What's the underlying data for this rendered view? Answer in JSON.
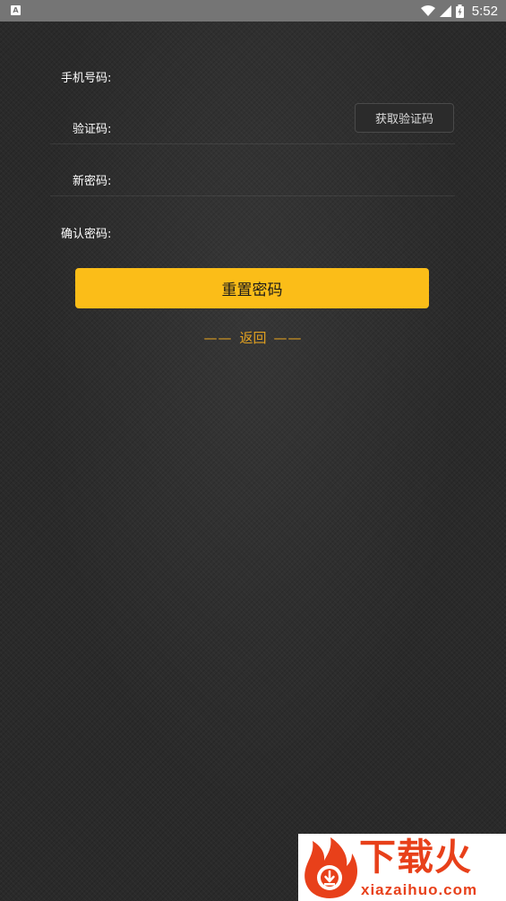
{
  "status_bar": {
    "notification_icon": "A",
    "time": "5:52"
  },
  "form": {
    "phone": {
      "label": "手机号码:",
      "value": "",
      "placeholder": ""
    },
    "code": {
      "label": "验证码:",
      "value": "",
      "placeholder": "",
      "get_code_label": "获取验证码"
    },
    "new_password": {
      "label": "新密码:",
      "value": "",
      "placeholder": ""
    },
    "confirm_password": {
      "label": "确认密码:",
      "value": "",
      "placeholder": ""
    },
    "reset_label": "重置密码",
    "back": {
      "left_dashes": "——",
      "label": "返回",
      "right_dashes": "——"
    }
  },
  "watermark": {
    "title": "下载火",
    "url": "xiazaihuo.com"
  },
  "colors": {
    "accent": "#fbbd18",
    "back_link": "#e0a020",
    "background": "#2a2a2a",
    "status_bar": "#757575",
    "watermark_red": "#e8401a"
  }
}
